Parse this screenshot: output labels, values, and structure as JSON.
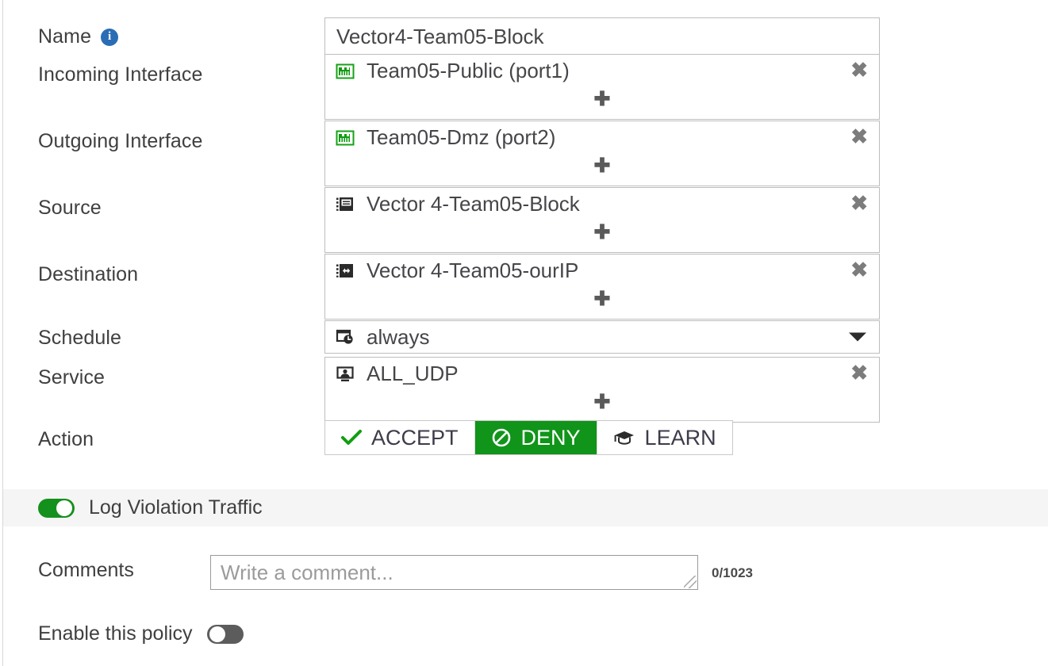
{
  "form": {
    "name": {
      "label": "Name",
      "info_icon": "info-icon",
      "value": "Vector4-Team05-Block"
    },
    "incoming_interface": {
      "label": "Incoming Interface",
      "icon": "network-port-icon",
      "value": "Team05-Public (port1)",
      "remove_glyph": "✖",
      "add_glyph": "✚"
    },
    "outgoing_interface": {
      "label": "Outgoing Interface",
      "icon": "network-port-icon",
      "value": "Team05-Dmz (port2)",
      "remove_glyph": "✖",
      "add_glyph": "✚"
    },
    "source": {
      "label": "Source",
      "icon": "address-object-icon",
      "value": "Vector 4-Team05-Block",
      "remove_glyph": "✖",
      "add_glyph": "✚"
    },
    "destination": {
      "label": "Destination",
      "icon": "ip-range-icon",
      "value": "Vector 4-Team05-ourIP",
      "remove_glyph": "✖",
      "add_glyph": "✚"
    },
    "schedule": {
      "label": "Schedule",
      "icon": "calendar-clock-icon",
      "value": "always"
    },
    "service": {
      "label": "Service",
      "icon": "service-monitor-icon",
      "value": "ALL_UDP",
      "remove_glyph": "✖",
      "add_glyph": "✚"
    },
    "action": {
      "label": "Action",
      "selected": "DENY",
      "options": [
        {
          "label": "ACCEPT",
          "icon": "check-icon",
          "active": false
        },
        {
          "label": "DENY",
          "icon": "deny-circle-slash-icon",
          "active": true
        },
        {
          "label": "LEARN",
          "icon": "graduation-cap-icon",
          "active": false
        }
      ]
    },
    "log_violation_traffic": {
      "label": "Log Violation Traffic",
      "state": "on"
    },
    "comments": {
      "label": "Comments",
      "placeholder": "Write a comment...",
      "value": "",
      "counter": "0/1023"
    },
    "enable_policy": {
      "label": "Enable this policy",
      "state": "off"
    }
  },
  "colors": {
    "accent_green": "#10941a",
    "info_blue": "#2a6db5",
    "band_gray": "#f5f5f5",
    "border_gray": "#bdbdbd"
  }
}
